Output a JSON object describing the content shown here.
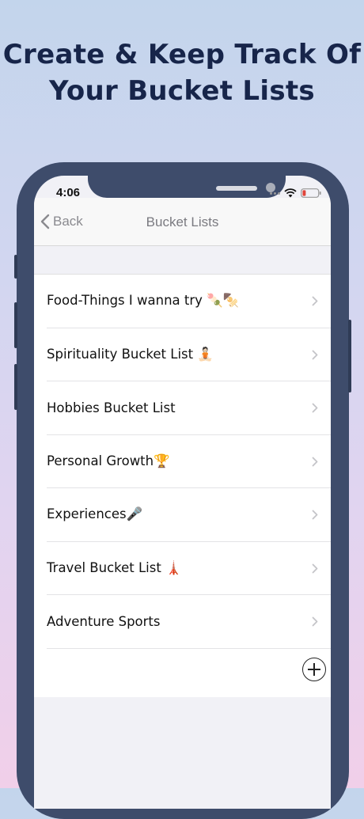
{
  "headline": {
    "line1": "Create & Keep Track Of",
    "line2": "Your Bucket Lists"
  },
  "status_bar": {
    "time": "4:06"
  },
  "navbar": {
    "back_label": "Back",
    "title": "Bucket Lists"
  },
  "lists": [
    {
      "label": "Food-Things I wanna try 🍡🍢"
    },
    {
      "label": "Spirituality Bucket List 🧘🏻"
    },
    {
      "label": "Hobbies Bucket List"
    },
    {
      "label": "Personal Growth🏆"
    },
    {
      "label": "Experiences🎤"
    },
    {
      "label": "Travel Bucket List 🗼"
    },
    {
      "label": "Adventure Sports"
    }
  ],
  "colors": {
    "headline": "#17254a",
    "phone_frame": "#3e4c6b",
    "battery_low": "#e0453a"
  }
}
